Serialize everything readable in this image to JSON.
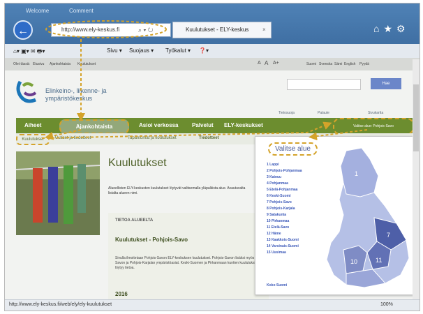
{
  "browser": {
    "address_url": "http://www.ely-keskus.fi",
    "tab_title": "Kuulutukset - ELY-keskus",
    "tab_close": "×",
    "top_tabs": [
      "Welcome",
      "Comment"
    ],
    "command_bar": [
      "Sivu ▾",
      "Suojaus ▾",
      "Työkalut ▾"
    ],
    "status_url": "http://www.ely-keskus.fi/web/ely/ely-kuulutukset",
    "zoom": "100%"
  },
  "site": {
    "topbar_left": [
      "Olet tässä:",
      "Etusivu",
      "Ajankohtaista",
      "Kuulutukset"
    ],
    "text_size": [
      "A",
      "A",
      "A+"
    ],
    "topbar_right": [
      "Suomi",
      "Svenska",
      "Sámi",
      "English",
      "Pyydä"
    ],
    "logo_text_line1": "Elinkeino-, liikenne- ja",
    "logo_text_line2": "ympäristökeskus",
    "search_button": "Hae",
    "utility_links": [
      "Tietosuoja",
      "Palaute",
      "Sivukartta"
    ],
    "nav": [
      "Aiheet",
      "Ajankohtaista",
      "Asioi verkossa",
      "Palvelut",
      "ELY-keskukset"
    ],
    "select_region_button": "Valitse alue: Pohjois-Savo",
    "subnav": [
      "Kuulutukset",
      "Uutiset ja tiedotteet",
      "Tapahtumat ja koulutukset",
      "Tiedotteet"
    ],
    "page_title": "Kuulutukset",
    "lead": "Alueellisten ELY-keskusten kuulutukset löytyvät valitsemalla yläpalkista alue. Avautuvalta listalta alueen nimi.",
    "panel_heading": "TIETOA ALUEELTA",
    "panel_title": "Kuulutukset - Pohjois-Savo",
    "panel_body": "Sivulla ilmoitetaan Pohjois-Savon ELY-keskuksen kuulutukset. Pohjois-Savon lisäksi myös Etelä-Savon ja Pohjois-Karjalan ympäristöasiat. Keski-Suomen ja Pirkanmaan kuntien kuulutuksista löytyy tietoa.",
    "year": "2016"
  },
  "dropdown": {
    "title": "Valitse alue",
    "regions": [
      "1 Lappi",
      "2 Pohjois-Pohjanmaa",
      "3 Kainuu",
      "4 Pohjanmaa",
      "5 Etelä-Pohjanmaa",
      "6 Keski-Suomi",
      "7 Pohjois-Savo",
      "8 Pohjois-Karjala",
      "9 Satakunta",
      "10 Pirkanmaa",
      "11 Etelä-Savo",
      "12 Häme",
      "13 Kaakkois-Suomi",
      "14 Varsinais-Suomi",
      "15 Uusimaa"
    ],
    "all_link": "Koko Suomi",
    "map_labels": [
      "1",
      "7",
      "10",
      "11"
    ]
  },
  "colors": {
    "nav_green": "#6c8d2f",
    "link_blue": "#3b58b8",
    "annotation": "#d4a32a"
  }
}
